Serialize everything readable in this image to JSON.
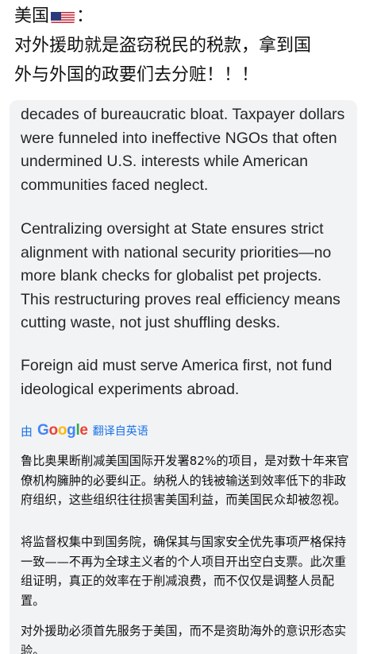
{
  "header": {
    "prefix": "美国",
    "suffix": "：",
    "line1": "对外援助就是盗窃税民的税款，拿到国",
    "line2": "外与外国的政要们去分赃！！！",
    "flag_icon": "us-flag-icon"
  },
  "tweet": {
    "para1": "decades of bureaucratic bloat. Taxpayer dollars were funneled into ineffective NGOs that often undermined U.S. interests while American communities faced neglect.",
    "para2": "Centralizing oversight at State ensures strict alignment with national security priorities—no more blank checks for globalist pet projects. This restructuring proves real efficiency means cutting waste, not just shuffling desks.",
    "para3": "Foreign aid must serve America first, not fund ideological experiments abroad."
  },
  "translation": {
    "by": "由",
    "google": [
      "G",
      "o",
      "o",
      "g",
      "l",
      "e"
    ],
    "label": "翻译自英语",
    "para1": "鲁比奥果断削减美国国际开发署82%的项目，是对数十年来官僚机构臃肿的必要纠正。纳税人的钱被输送到效率低下的非政府组织，这些组织往往损害美国利益，而美国民众却被忽视。",
    "para2": "将监督权集中到国务院，确保其与国家安全优先事项严格保持一致——不再为全球主义者的个人项目开出空白支票。此次重组证明，真正的效率在于削减浪费，而不仅仅是调整人员配置。",
    "para3": "对外援助必须首先服务于美国，而不是资助海外的意识形态实验。"
  },
  "colors": {
    "translate_blue": "#1a73e8",
    "google_blue": "#4285F4",
    "google_red": "#EA4335",
    "google_yellow": "#FBBC05",
    "google_green": "#34A853"
  }
}
